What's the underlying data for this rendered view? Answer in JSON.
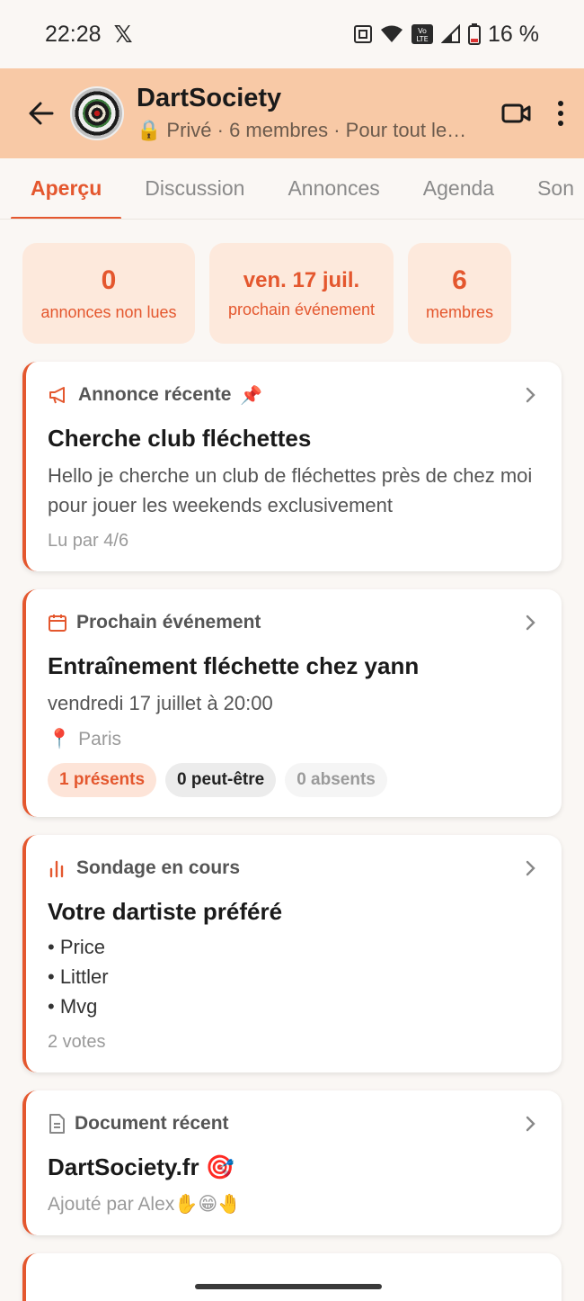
{
  "status_bar": {
    "time": "22:28",
    "x_app": "𝕏",
    "battery": "16 %"
  },
  "header": {
    "title": "DartSociety",
    "subtitle": "Privé · 6 membres · Pour tout le…"
  },
  "tabs": [
    {
      "label": "Aperçu"
    },
    {
      "label": "Discussion"
    },
    {
      "label": "Annonces"
    },
    {
      "label": "Agenda"
    },
    {
      "label": "Son"
    }
  ],
  "stats": [
    {
      "value": "0",
      "label": "annonces non lues"
    },
    {
      "value": "ven. 17 juil.",
      "label": "prochain événement"
    },
    {
      "value": "6",
      "label": "membres"
    }
  ],
  "announcement": {
    "header": "Annonce récente",
    "pin": "📌",
    "title": "Cherche club fléchettes",
    "body": "Hello je cherche un club de fléchettes près de chez moi pour jouer les weekends exclusivement",
    "meta": "Lu par 4/6"
  },
  "event": {
    "header": "Prochain événement",
    "title": "Entraînement fléchette chez yann",
    "date": "vendredi 17 juillet à 20:00",
    "location": "Paris",
    "rsvp": {
      "present": "1 présents",
      "maybe": "0 peut-être",
      "absent": "0 absents"
    }
  },
  "poll": {
    "header": "Sondage en cours",
    "title": "Votre dartiste préféré",
    "options": [
      "• Price",
      "• Littler",
      "• Mvg"
    ],
    "meta": "2 votes"
  },
  "document": {
    "header": "Document récent",
    "title": "DartSociety.fr 🎯",
    "meta": "Ajouté par Alex✋😁🤚"
  },
  "colors": {
    "accent": "#e4572e",
    "appbar": "#f8c9a6",
    "stat_bg": "#fde9dc"
  }
}
